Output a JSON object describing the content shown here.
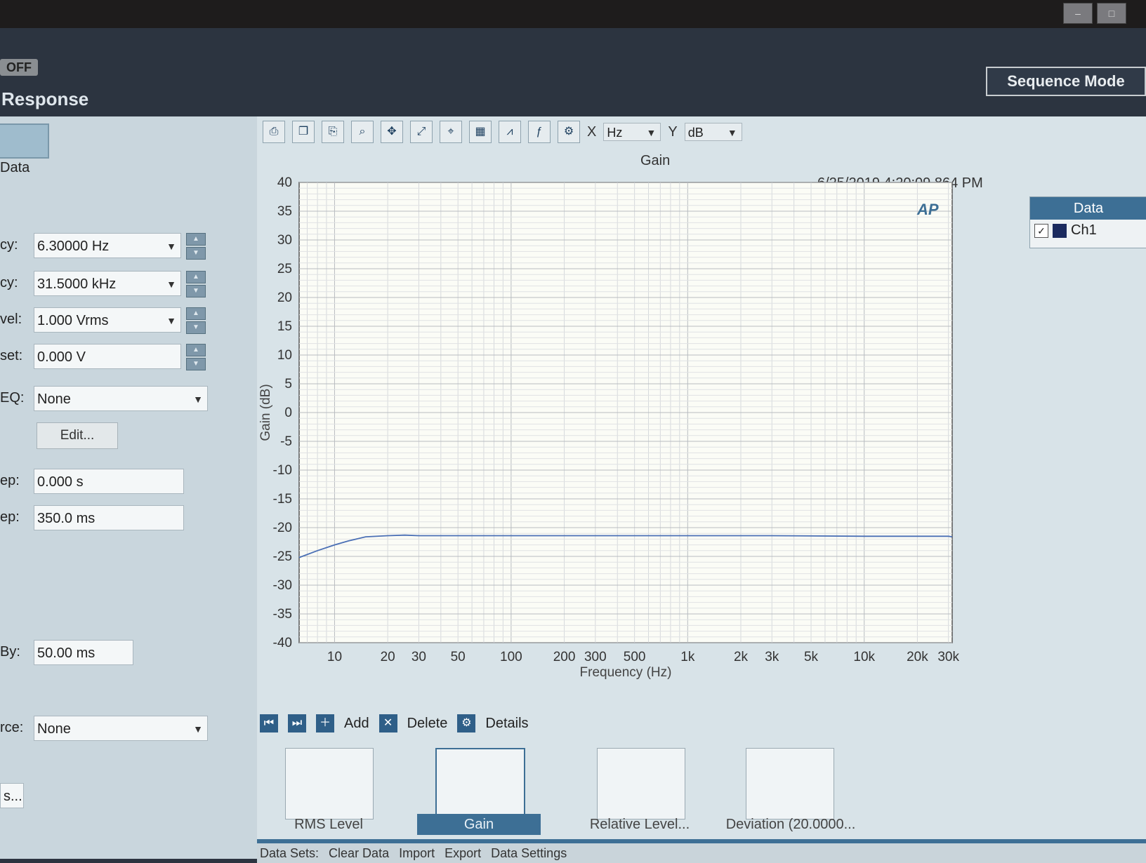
{
  "window": {
    "sequence_mode_label": "Sequence Mode",
    "toggle_label": "OFF"
  },
  "panel": {
    "title": "Response",
    "data_label": "Data",
    "fields": [
      {
        "label": "cy:",
        "value": "6.30000 Hz"
      },
      {
        "label": "cy:",
        "value": "31.5000 kHz"
      },
      {
        "label": "vel:",
        "value": "1.000 Vrms"
      },
      {
        "label": "set:",
        "value": "0.000 V"
      },
      {
        "label": "EQ:",
        "value": "None"
      },
      {
        "label": "ep:",
        "value": "0.000 s"
      },
      {
        "label": "ep:",
        "value": "350.0 ms"
      },
      {
        "label": "By:",
        "value": "50.00 ms"
      },
      {
        "label": "rce:",
        "value": "None"
      }
    ],
    "edit_button": "Edit...",
    "more_button": "s..."
  },
  "toolbar": {
    "x_label": "X",
    "x_unit": "Hz",
    "y_label": "Y",
    "y_unit": "dB"
  },
  "legend": {
    "title": "Data",
    "series": "Ch1",
    "checked": "✓"
  },
  "bottom_toolbar": {
    "add": "Add",
    "delete": "Delete",
    "details": "Details"
  },
  "thumbnails": [
    "RMS Level",
    "Gain",
    "Relative Level...",
    "Deviation (20.0000..."
  ],
  "datasets_bar": [
    "Data Sets:",
    "Clear Data",
    "Import",
    "Export",
    "Data Settings"
  ],
  "chart_data": {
    "type": "line",
    "title": "Gain",
    "timestamp": "6/25/2019 4:20:09.864 PM",
    "xlabel": "Frequency (Hz)",
    "ylabel": "Gain (dB)",
    "x_scale": "log",
    "xlim": [
      6.3,
      31500
    ],
    "ylim": [
      -40,
      40
    ],
    "grid": true,
    "x_ticks": [
      10,
      20,
      30,
      50,
      100,
      200,
      300,
      500,
      1000,
      2000,
      3000,
      5000,
      10000,
      20000,
      30000
    ],
    "x_tick_labels": [
      "10",
      "20",
      "30",
      "50",
      "100",
      "200",
      "300",
      "500",
      "1k",
      "2k",
      "3k",
      "5k",
      "10k",
      "20k",
      "30k"
    ],
    "y_ticks": [
      40,
      35,
      30,
      25,
      20,
      15,
      10,
      5,
      0,
      -5,
      -10,
      -15,
      -20,
      -25,
      -30,
      -35,
      -40
    ],
    "series": [
      {
        "name": "Ch1",
        "color": "#4a6fb5",
        "x": [
          6.3,
          8,
          10,
          12,
          15,
          20,
          25,
          30,
          50,
          100,
          300,
          1000,
          3000,
          10000,
          20000,
          30000,
          31500
        ],
        "y": [
          -25.2,
          -24,
          -23,
          -22.3,
          -21.6,
          -21.4,
          -21.3,
          -21.4,
          -21.4,
          -21.4,
          -21.4,
          -21.4,
          -21.4,
          -21.5,
          -21.5,
          -21.5,
          -21.6
        ]
      }
    ]
  }
}
